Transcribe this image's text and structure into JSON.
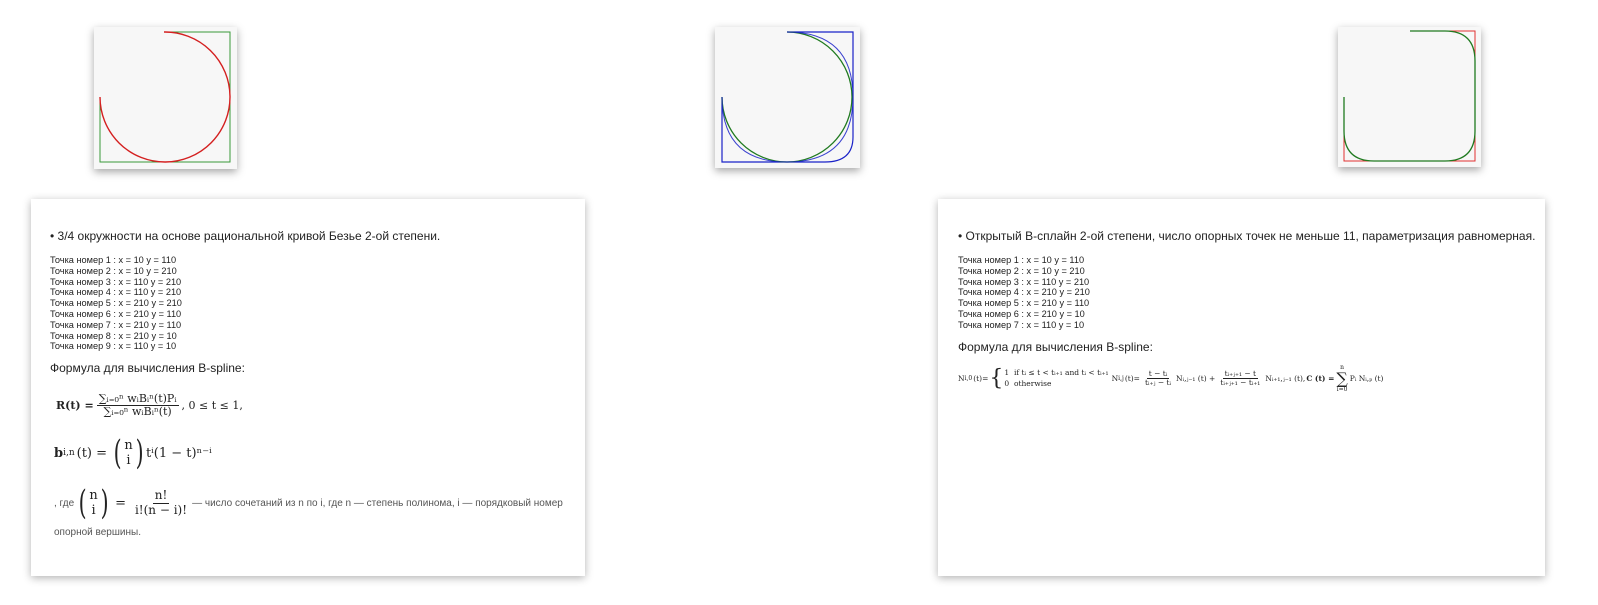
{
  "left_card": {
    "heading": "• 3/4 окружности на основе рациональной кривой Безье 2-ой степени.",
    "points": [
      "Точка номер 1 : x = 10 y = 110",
      "Точка номер 2 : x = 10 y = 210",
      "Точка номер 3 : x = 110 y = 210",
      "Точка номер 4 : x = 110 y = 210",
      "Точка номер 5 : x = 210 y = 210",
      "Точка номер 6 : x = 210 y = 110",
      "Точка номер 7 : x = 210 y = 110",
      "Точка номер 8 : x = 210 y = 10",
      "Точка номер 9 : x = 110 y = 10"
    ],
    "formula_title": "Формула для вычисления B-spline:",
    "formula_rt": {
      "lhs": "R(t) =",
      "num": "∑ᵢ₌₀ⁿ wᵢBᵢⁿ(t)Pᵢ",
      "den": "∑ᵢ₌₀ⁿ wᵢBᵢⁿ(t)",
      "range": ",   0 ≤ t ≤ 1,"
    },
    "formula_bin": {
      "lhs": "b",
      "lhs_sub": "i,n",
      "mid": "(t) =",
      "top": "n",
      "bottom": "i",
      "rhs": "tⁱ(1 − t)ⁿ⁻ⁱ"
    },
    "explanation": {
      "prefix": ", где",
      "binom_top": "n",
      "binom_bottom": "i",
      "equals": "=",
      "frac_num": "n!",
      "frac_den": "i!(n − i)!",
      "text": "— число сочетаний из n по i, где n — степень полинома, i — порядковый номер",
      "text2": "опорной вершины."
    }
  },
  "right_card": {
    "heading": "• Открытый B-сплайн 2-ой степени, число опорных точек не меньше 11, параметризация равномерная.",
    "points": [
      "Точка номер 1 : x = 10 y = 110",
      "Точка номер 2 : x = 10 y = 210",
      "Точка номер 3 : x = 110 y = 210",
      "Точка номер 4 : x = 210 y = 210",
      "Точка номер 5 : x = 210 y = 110",
      "Точка номер 6 : x = 210 y = 10",
      "Точка номер 7 : x = 110 y = 10"
    ],
    "formula_title": "Формула для вычисления B-spline:",
    "formula": {
      "n_lhs": "N",
      "n_lhs_sub": "i,0",
      "n_lhs_arg": "(t)=",
      "case1_val": "1",
      "case1_cond": "if  tᵢ ≤ t < tᵢ₊₁  and  tᵢ < tᵢ₊₁",
      "case2_val": "0",
      "case2_cond": "otherwise",
      "nij": "N",
      "nij_sub": "i,j",
      "nij_arg": "(t)=",
      "f1_num": "t − tᵢ",
      "f1_den": "tᵢ₊ⱼ − tᵢ",
      "term1": "Nᵢ,ⱼ₋₁ (t) +",
      "f2_num": "tᵢ₊ⱼ₊₁ − t",
      "f2_den": "tᵢ₊ⱼ₊₁ − tᵢ₊₁",
      "term2": "Nᵢ₊₁,ⱼ₋₁ (t),",
      "c": "C (t) =",
      "sum_top": "n",
      "sum_bottom": "i=0",
      "sum_body": "Pᵢ Nᵢ,ₚ (t)"
    }
  },
  "colors": {
    "control_green": "#3a9a3a",
    "curve_red": "#d42020",
    "control_blue": "#1a22c8",
    "curve_green": "#207a20",
    "control_red": "#e03030",
    "canvas_bg": "#f7f7f7"
  }
}
